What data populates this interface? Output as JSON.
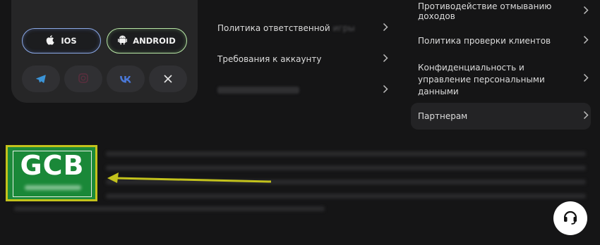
{
  "app_card": {
    "ios_label": "IOS",
    "android_label": "ANDROID",
    "social": [
      "telegram-icon",
      "instagram-icon",
      "vk-icon",
      "x-icon"
    ]
  },
  "links_middle": [
    {
      "label": "Политика ответственной",
      "faded": "игры"
    },
    {
      "label": "Требования к аккаунту"
    },
    {
      "label": ""
    }
  ],
  "links_right": [
    {
      "label": "Противодействие отмыванию доходов"
    },
    {
      "label": "Политика проверки клиентов"
    },
    {
      "label": "Конфиденциальность и управление персональными данными"
    },
    {
      "label": "Партнерам"
    }
  ],
  "logo": {
    "text": "GCB"
  },
  "colors": {
    "background": "#151516",
    "highlight_frame": "#c3c21c",
    "logo_green": "#1c8a3a"
  }
}
